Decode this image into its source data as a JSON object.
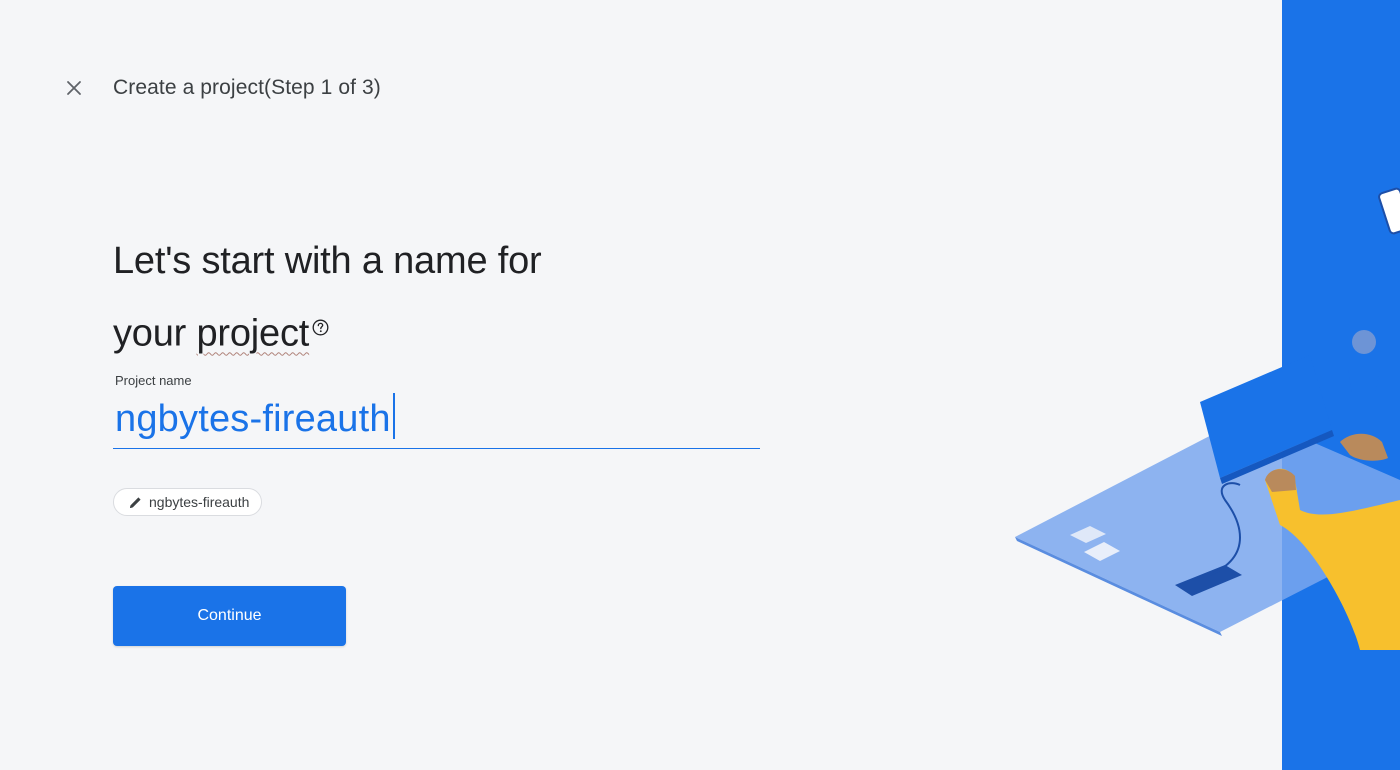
{
  "header": {
    "title": "Create a project(Step 1 of 3)"
  },
  "main": {
    "headline_line1": "Let's start with a name for",
    "headline_line2_prefix": "your ",
    "headline_line2_word": "project",
    "field": {
      "label": "Project name",
      "value": "ngbytes-fireauth"
    },
    "project_id_chip": "ngbytes-fireauth",
    "continue_label": "Continue"
  },
  "icons": {
    "close": "close-icon",
    "help": "help-icon",
    "edit": "pencil-icon"
  },
  "colors": {
    "accent": "#1a73e8",
    "background": "#f5f6f8",
    "text": "#202124"
  }
}
